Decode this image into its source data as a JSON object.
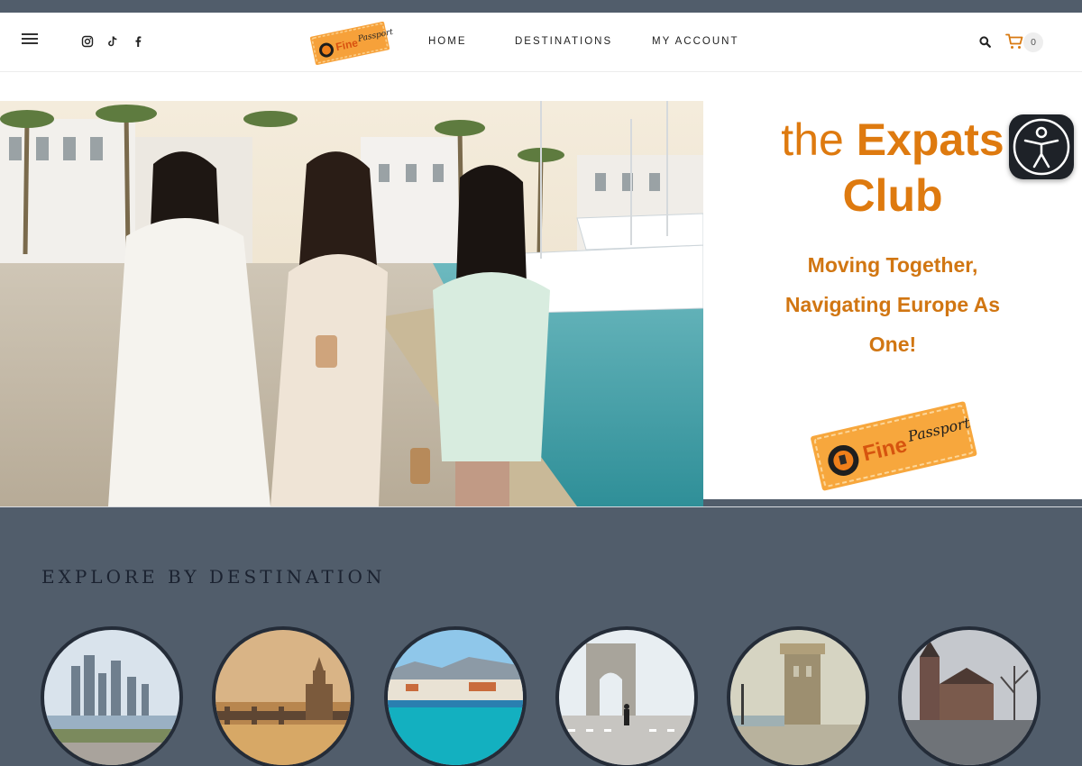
{
  "header": {
    "menu_icon": "hamburger-menu-icon",
    "social": [
      {
        "name": "instagram-icon"
      },
      {
        "name": "tiktok-icon"
      },
      {
        "name": "facebook-icon"
      }
    ],
    "logo_text": {
      "a": "Fine",
      "b": "Passport"
    },
    "nav": [
      "HOME",
      "DESTINATIONS",
      "MY ACCOUNT"
    ],
    "search_icon": "search-icon",
    "cart_icon": "cart-icon",
    "cart_count": "0"
  },
  "hero": {
    "title_light": "the",
    "title_bold_1": "Expats",
    "title_bold_2": "Club",
    "subtitle_lines": [
      "Moving Together,",
      "Navigating Europe As",
      "One!"
    ],
    "stamp_text": {
      "a": "Fine",
      "b": "Passport"
    }
  },
  "accessibility_icon": "accessibility-icon",
  "explore": {
    "title": "EXPLORE BY DESTINATION"
  },
  "colors": {
    "accent": "#de7a0f",
    "band": "#515d6b"
  }
}
